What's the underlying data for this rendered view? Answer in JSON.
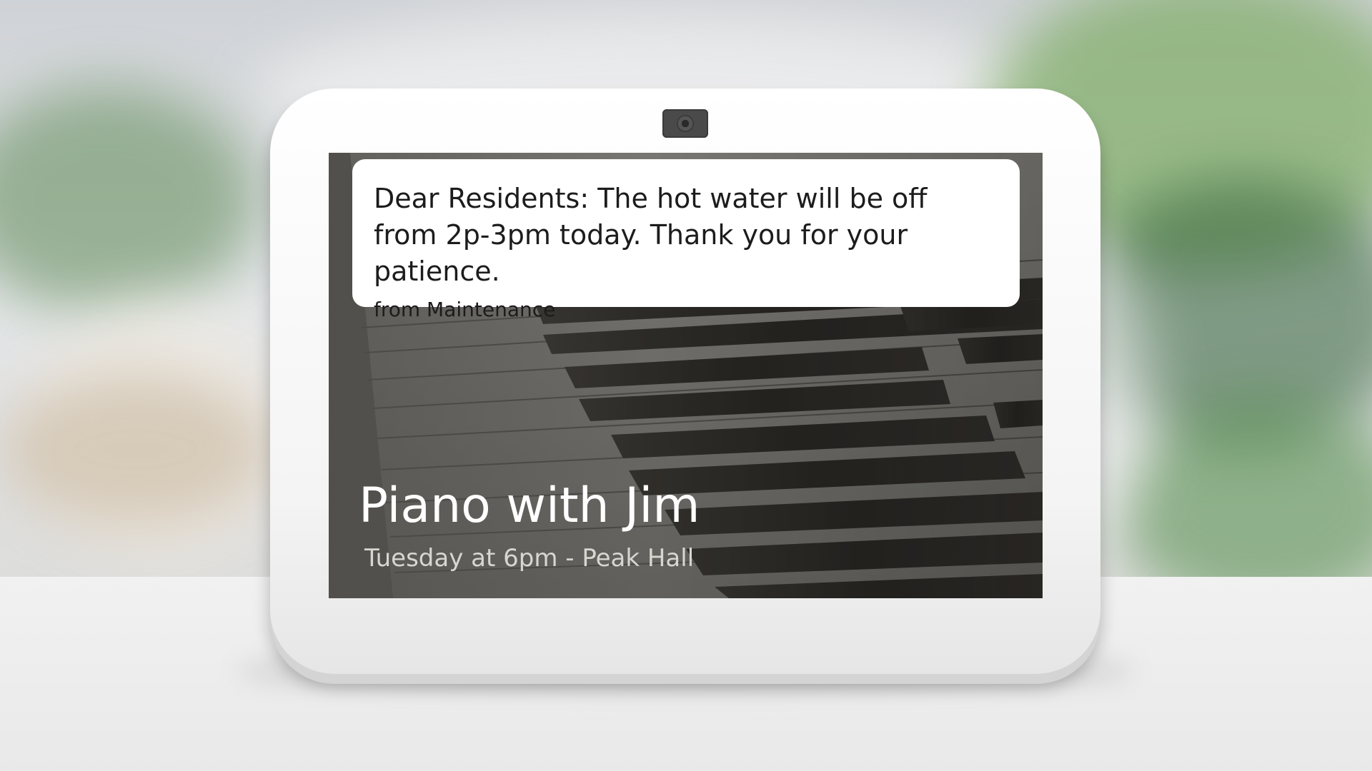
{
  "notification": {
    "message": "Dear Residents: The hot water will be off from 2p-3pm today. Thank you for your patience.",
    "sender": "from Maintenance"
  },
  "event": {
    "title": "Piano with Jim",
    "subtitle": "Tuesday at 6pm - Peak Hall"
  },
  "background_image": "piano-keys",
  "colors": {
    "card": "#ffffff",
    "device_frame": "#f4f4f4",
    "camera": "#4a4a4a",
    "event_title": "#ffffff",
    "event_subtitle": "#d9d6d0"
  }
}
